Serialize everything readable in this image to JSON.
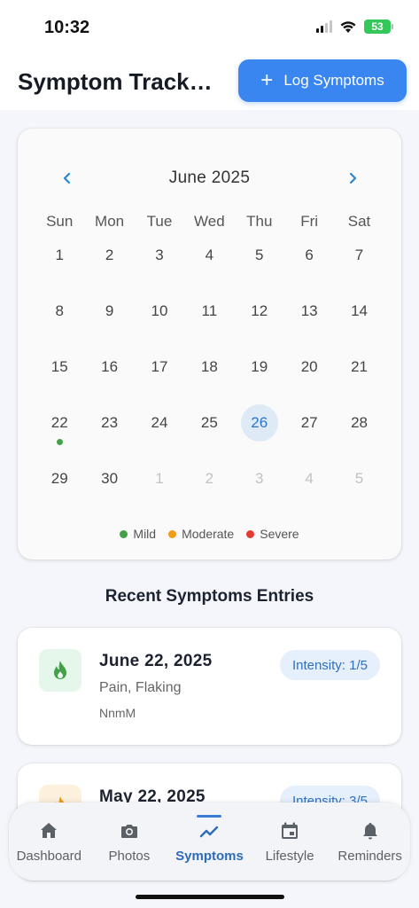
{
  "status_bar": {
    "time": "10:32",
    "battery": "53"
  },
  "header": {
    "title": "Symptom Tracking",
    "log_button_label": "Log Symptoms"
  },
  "calendar": {
    "month_label": "June 2025",
    "weekdays": [
      "Sun",
      "Mon",
      "Tue",
      "Wed",
      "Thu",
      "Fri",
      "Sat"
    ],
    "rows": [
      [
        "1",
        "2",
        "3",
        "4",
        "5",
        "6",
        "7"
      ],
      [
        "8",
        "9",
        "10",
        "11",
        "12",
        "13",
        "14"
      ],
      [
        "15",
        "16",
        "17",
        "18",
        "19",
        "20",
        "21"
      ],
      [
        "22",
        "23",
        "24",
        "25",
        "26",
        "27",
        "28"
      ],
      [
        "29",
        "30",
        "1",
        "2",
        "3",
        "4",
        "5"
      ]
    ],
    "today": "26",
    "legend": [
      {
        "label": "Mild",
        "color": "#43a047"
      },
      {
        "label": "Moderate",
        "color": "#f29b15"
      },
      {
        "label": "Severe",
        "color": "#e53935"
      }
    ]
  },
  "recent": {
    "title": "Recent Symptoms Entries",
    "entries": [
      {
        "date": "June 22, 2025",
        "symptoms": "Pain, Flaking",
        "notes": "NnmM",
        "intensity": "Intensity: 1/5",
        "icon": "flame-icon",
        "icon_bg": "#e5f6ea",
        "icon_color": "#43a047"
      },
      {
        "date": "May 22, 2025",
        "symptoms": "",
        "notes": "",
        "intensity": "Intensity: 3/5",
        "icon": "flame-icon",
        "icon_bg": "#fdf0dc",
        "icon_color": "#f29b15"
      }
    ]
  },
  "tabs": [
    {
      "label": "Dashboard",
      "icon": "home-icon"
    },
    {
      "label": "Photos",
      "icon": "camera-icon"
    },
    {
      "label": "Symptoms",
      "icon": "trend-icon",
      "active": true
    },
    {
      "label": "Lifestyle",
      "icon": "calendar-icon"
    },
    {
      "label": "Reminders",
      "icon": "bell-icon"
    }
  ]
}
